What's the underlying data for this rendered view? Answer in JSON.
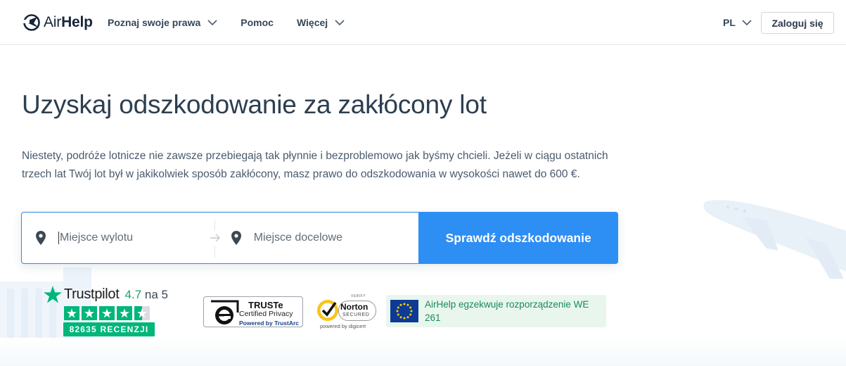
{
  "header": {
    "logo_left": "Air",
    "logo_right": "Help",
    "nav": [
      {
        "label": "Poznaj swoje prawa",
        "has_dropdown": true
      },
      {
        "label": "Pomoc",
        "has_dropdown": false
      },
      {
        "label": "Więcej",
        "has_dropdown": true
      }
    ],
    "language": "PL",
    "login_label": "Zaloguj się"
  },
  "hero": {
    "title": "Uzyskaj odszkodowanie za zakłócony lot",
    "description": "Niestety, podróże lotnicze nie zawsze przebiegają tak płynnie i bezproblemowo jak byśmy chcieli. Jeżeli w ciągu ostatnich trzech lat Twój lot był w jakikolwiek sposób zakłócony, masz prawo do odszkodowania w wysokości nawet do 600 €."
  },
  "search": {
    "from_placeholder": "Miejsce wylotu",
    "to_placeholder": "Miejsce docelowe",
    "button_label": "Sprawdź odszkodowanie"
  },
  "trust": {
    "trustpilot": {
      "brand": "Trustpilot",
      "rating": "4.7",
      "rating_suffix": "na 5",
      "stars": 4.5,
      "reviews": "82635 RECENZJI"
    },
    "truste": {
      "title": "TRUSTe",
      "subtitle": "Certified Privacy",
      "powered": "Powered by TrustArc"
    },
    "norton": {
      "verify": "VERIFY",
      "name": "Norton",
      "secured": "SECURED",
      "powered": "powered by digicert"
    },
    "eu_text": "AirHelp egzekwuje rozporządzenie WE 261"
  },
  "colors": {
    "primary_blue": "#2d8ef4",
    "trustpilot_green": "#00b67a",
    "eu_green": "#168b57",
    "eu_bg": "#e9f6ee",
    "text_dark": "#2d3e50"
  }
}
